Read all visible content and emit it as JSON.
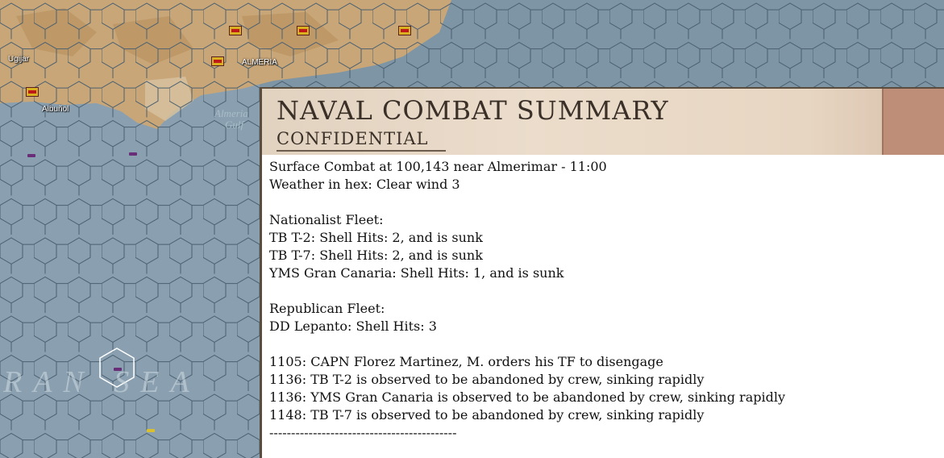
{
  "map": {
    "towns": {
      "ugijar": "Ugijar",
      "almeria": "ALMERIA",
      "albunol": "Albuñol"
    },
    "gulf_label_line1": "Almeria",
    "gulf_label_line2": "Gulf",
    "sea_label": "RAN SEA",
    "colors": {
      "sea": "#7d95a5",
      "land": "#c9a677",
      "unit_flag_red": "#c0191a",
      "unit_flag_yellow": "#d8b020"
    }
  },
  "dialog": {
    "title": "NAVAL COMBAT SUMMARY",
    "subtitle": "CONFIDENTIAL",
    "lines": [
      "Surface Combat at 100,143 near Almerimar - 11:00",
      "Weather in hex: Clear wind 3",
      "",
      "Nationalist Fleet:",
      "TB T-2: Shell Hits: 2, and is sunk",
      "TB T-7: Shell Hits: 2, and is sunk",
      "YMS Gran Canaria: Shell Hits: 1, and is sunk",
      "",
      "Republican Fleet:",
      "DD Lepanto: Shell Hits: 3",
      "",
      "1105: CAPN Florez Martinez, M. orders his TF to disengage",
      "1136: TB T-2 is observed to be abandoned by crew, sinking rapidly",
      "1136: YMS Gran Canaria is observed to be abandoned by crew, sinking rapidly",
      "1148: TB T-7 is observed to be abandoned by crew, sinking rapidly",
      "-------------------------------------------"
    ]
  }
}
